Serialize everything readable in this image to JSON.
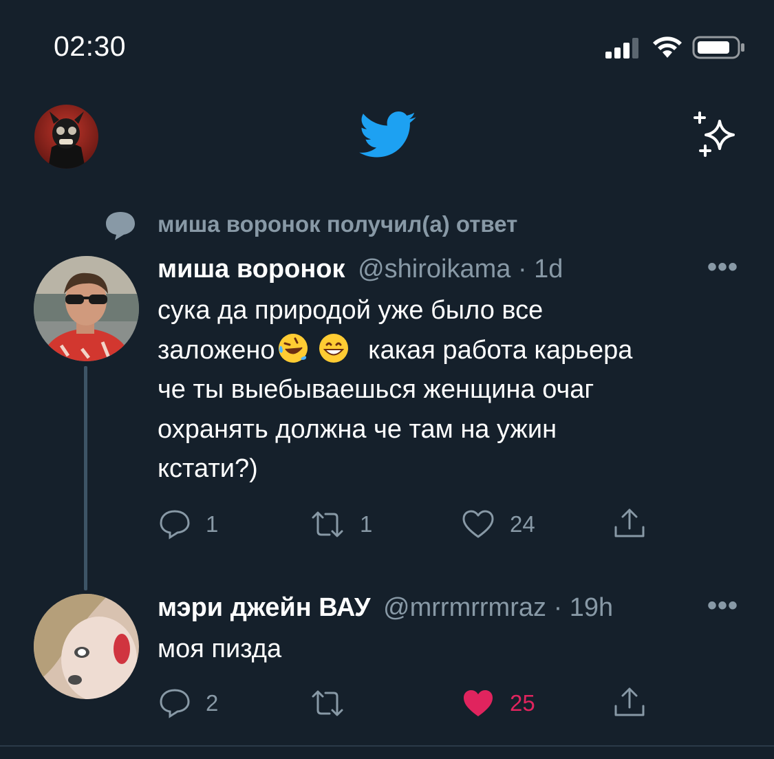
{
  "status_bar": {
    "time": "02:30"
  },
  "nav": {
    "profile_icon": "profile-avatar",
    "logo_icon": "twitter-bird-icon",
    "action_icon": "sparkle-icon"
  },
  "context": {
    "text": "миша воронок получил(а) ответ",
    "icon": "reply-bubble-icon"
  },
  "tweets": [
    {
      "name": "миша воронок",
      "handle": "@shiroikama",
      "time": "· 1d",
      "text_lines": [
        "сука да природой уже было все",
        "заложено",
        "какая работа карьера",
        "че ты выебываешься женщина очаг",
        "охранять должна че там на ужин",
        "кстати?)"
      ],
      "emojis": [
        "rolling-on-floor-laughing-emoji",
        "grinning-face-emoji"
      ],
      "replies": "1",
      "retweets": "1",
      "likes": "24",
      "liked": false
    },
    {
      "name": "мэри джейн ВАУ",
      "handle": "@mrrmrrmraz",
      "time": "· 19h",
      "text_lines": [
        "моя пизда"
      ],
      "replies": "2",
      "retweets": "",
      "likes": "25",
      "liked": true
    }
  ],
  "colors": {
    "background": "#15202b",
    "secondary_text": "#8899a6",
    "accent": "#1da1f2",
    "like": "#e0245e",
    "thread_line": "#3d5466"
  }
}
